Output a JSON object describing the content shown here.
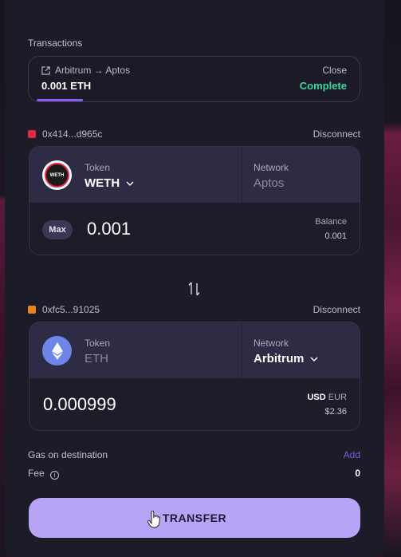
{
  "transactions": {
    "title": "Transactions",
    "route": "Arbitrum → Aptos",
    "close": "Close",
    "amount": "0.001 ETH",
    "status": "Complete",
    "progress": 0.14
  },
  "from": {
    "wallet_address": "0x414...d965c",
    "disconnect": "Disconnect",
    "token_label": "Token",
    "token_value": "WETH",
    "token_icon_text": "WETH",
    "network_label": "Network",
    "network_value": "Aptos",
    "max_label": "Max",
    "amount": "0.001",
    "balance_label": "Balance",
    "balance_value": "0.001"
  },
  "to": {
    "wallet_address": "0xfc5...91025",
    "disconnect": "Disconnect",
    "token_label": "Token",
    "token_value": "ETH",
    "network_label": "Network",
    "network_value": "Arbitrum",
    "amount": "0.000999",
    "currency_active": "USD",
    "currency_other": "EUR",
    "fiat_value": "$2.36"
  },
  "gas": {
    "label": "Gas on destination",
    "action": "Add"
  },
  "fee": {
    "label": "Fee",
    "value": "0"
  },
  "transfer_button": "TRANSFER",
  "colors": {
    "accent": "#b7a4f6",
    "status_complete": "#3fd79e",
    "link": "#7d5ce0"
  }
}
